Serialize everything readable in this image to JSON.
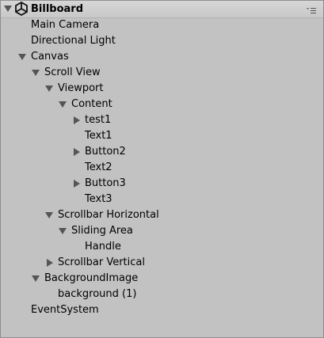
{
  "scene": {
    "name": "Billboard",
    "expanded": true,
    "icon": "unity-logo-icon",
    "menu_icon": "context-menu-icon"
  },
  "hierarchy": [
    {
      "name": "Main Camera",
      "depth": 1,
      "arrow": "none"
    },
    {
      "name": "Directional Light",
      "depth": 1,
      "arrow": "none"
    },
    {
      "name": "Canvas",
      "depth": 1,
      "arrow": "expanded"
    },
    {
      "name": "Scroll View",
      "depth": 2,
      "arrow": "expanded"
    },
    {
      "name": "Viewport",
      "depth": 3,
      "arrow": "expanded"
    },
    {
      "name": "Content",
      "depth": 4,
      "arrow": "expanded"
    },
    {
      "name": "test1",
      "depth": 5,
      "arrow": "collapsed"
    },
    {
      "name": "Text1",
      "depth": 5,
      "arrow": "none"
    },
    {
      "name": "Button2",
      "depth": 5,
      "arrow": "collapsed"
    },
    {
      "name": "Text2",
      "depth": 5,
      "arrow": "none"
    },
    {
      "name": "Button3",
      "depth": 5,
      "arrow": "collapsed"
    },
    {
      "name": "Text3",
      "depth": 5,
      "arrow": "none"
    },
    {
      "name": "Scrollbar Horizontal",
      "depth": 3,
      "arrow": "expanded"
    },
    {
      "name": "Sliding Area",
      "depth": 4,
      "arrow": "expanded"
    },
    {
      "name": "Handle",
      "depth": 5,
      "arrow": "none"
    },
    {
      "name": "Scrollbar Vertical",
      "depth": 3,
      "arrow": "collapsed"
    },
    {
      "name": "BackgroundImage",
      "depth": 2,
      "arrow": "expanded"
    },
    {
      "name": "background (1)",
      "depth": 3,
      "arrow": "none"
    },
    {
      "name": "EventSystem",
      "depth": 1,
      "arrow": "none"
    }
  ],
  "colors": {
    "panel_bg": "#c2c2c2",
    "text": "#000000",
    "arrow": "#555555"
  }
}
